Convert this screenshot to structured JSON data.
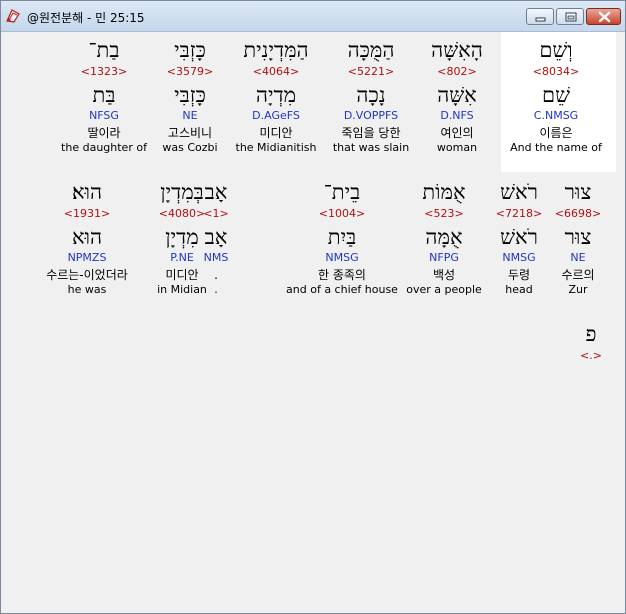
{
  "window": {
    "title": "@원전분해 - 민 25:15",
    "icon": "bible-app-icon",
    "controls": [
      "minimize-icon",
      "maximize-icon",
      "close-icon"
    ]
  },
  "rows": [
    {
      "words": [
        {
          "heb": "וְשֵׁם",
          "strong": "<8034>",
          "lex": "שֵׁם",
          "morph": "C.NMSG",
          "kor": "이름은",
          "eng": "And the name of"
        },
        {
          "heb": "הָאִשָּׁה",
          "strong": "<802>",
          "lex": "אִשָּׁה",
          "morph": "D.NFS",
          "kor": "여인의",
          "eng": "woman"
        },
        {
          "heb": "הַמֻּכָּה",
          "strong": "<5221>",
          "lex": "נָכָה",
          "morph": "D.VOPPFS",
          "kor": "죽임을 당한",
          "eng": "that was slain"
        },
        {
          "heb": "הַמִּדְיָנִית",
          "strong": "<4064>",
          "lex": "מִדְיָה",
          "morph": "D.AGeFS",
          "kor": "미디안",
          "eng": "the Midianitish"
        },
        {
          "heb": "כָּזְבִּי",
          "strong": "<3579>",
          "lex": "כָּזְבִּי",
          "morph": "NE",
          "kor": "고스비니",
          "eng": "was Cozbi"
        },
        {
          "heb": "בַת־",
          "strong": "<1323>",
          "lex": "בַּת",
          "morph": "NFSG",
          "kor": "딸이라",
          "eng": "the daughter of"
        }
      ]
    },
    {
      "words": [
        {
          "heb": "צוּר",
          "strong": "<6698>",
          "lex": "צוּר",
          "morph": "NE",
          "kor": "수르의",
          "eng": "Zur"
        },
        {
          "heb": "רֹאשׁ",
          "strong": "<7218>",
          "lex": "רֹאשׁ",
          "morph": "NMSG",
          "kor": "두령",
          "eng": "head"
        },
        {
          "heb": "אֻמּוֹת",
          "strong": "<523>",
          "lex": "אֻמָּה",
          "morph": "NFPG",
          "kor": "백성",
          "eng": "over a people"
        },
        {
          "heb": "בֵית־",
          "strong": "<1004>",
          "lex": "בַּיִת",
          "morph": "NMSG",
          "kor": "한 종족의",
          "eng": "and of a chief house"
        },
        {
          "heb": "אָב",
          "strong": "<1>",
          "lex": "אָב",
          "morph": "NMS",
          "kor": ".",
          "eng": "."
        },
        {
          "heb": "בְּמִדְיָן",
          "strong": "<4080>",
          "lex": "מִדְיָן",
          "morph": "P.NE",
          "kor": "미디안",
          "eng": "in Midian"
        },
        {
          "heb": "הוּא׃",
          "strong": "<1931>",
          "lex": "הוּא",
          "morph": "NPMZS",
          "kor": "수르는-이었더라",
          "eng": "he was"
        }
      ]
    },
    {
      "words": [
        {
          "heb": "פ",
          "strong": "<.>"
        }
      ]
    }
  ]
}
